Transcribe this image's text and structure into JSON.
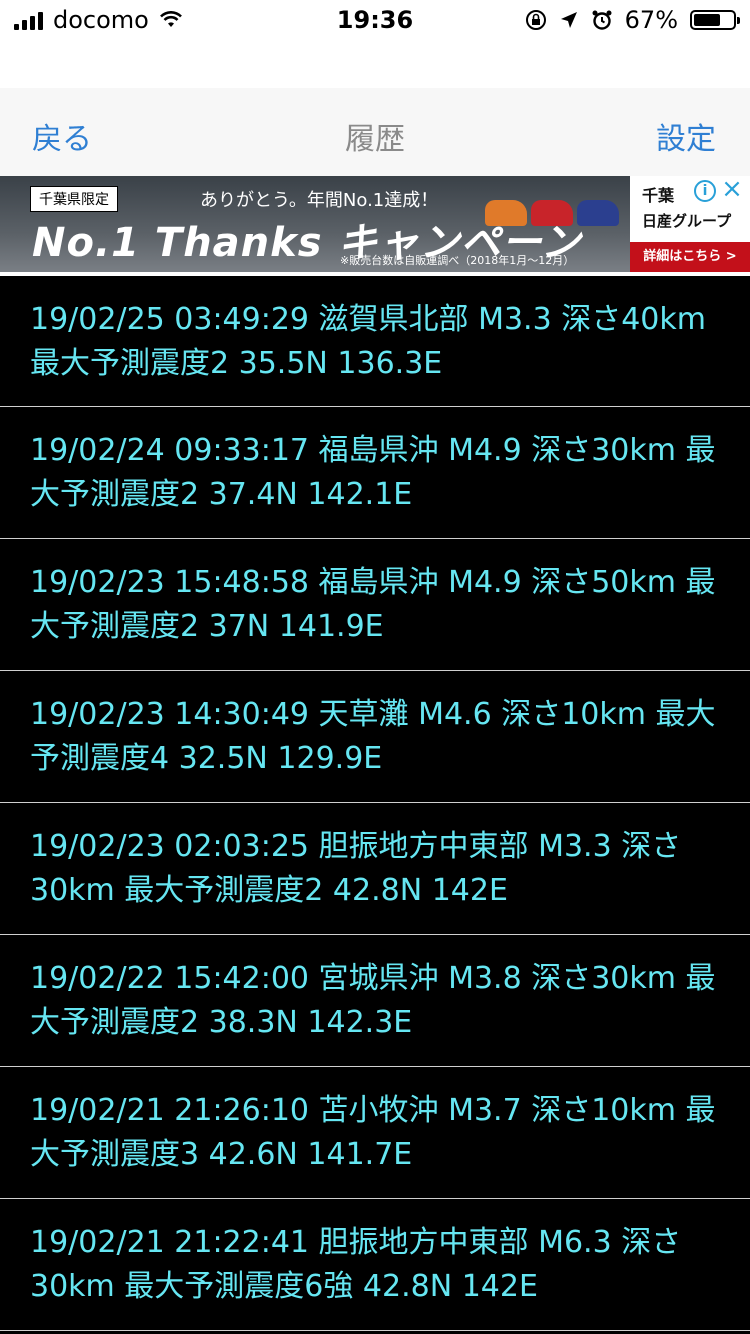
{
  "status_bar": {
    "carrier": "docomo",
    "time": "19:36",
    "battery": "67%"
  },
  "nav": {
    "back_label": "戻る",
    "title": "履歴",
    "settings_label": "設定"
  },
  "ad": {
    "tag": "千葉県限定",
    "headline_small": "ありがとう。年間No.1達成！",
    "headline": "No.1 Thanks キャンペーン",
    "fineprint": "※販売台数は自販連調べ（2018年1月〜12月）",
    "brand_name": "千葉",
    "brand_group": "日産グループ",
    "detail_button": "詳細はこちら >"
  },
  "history": [
    "19/02/25 03:49:29 滋賀県北部 M3.3 深さ40km 最大予測震度2 35.5N 136.3E",
    "19/02/24 09:33:17 福島県沖 M4.9 深さ30km 最大予測震度2 37.4N 142.1E",
    "19/02/23 15:48:58 福島県沖 M4.9 深さ50km 最大予測震度2 37N 141.9E",
    "19/02/23 14:30:49 天草灘 M4.6 深さ10km 最大予測震度4 32.5N 129.9E",
    "19/02/23 02:03:25 胆振地方中東部 M3.3 深さ30km 最大予測震度2 42.8N 142E",
    "19/02/22 15:42:00 宮城県沖 M3.8 深さ30km 最大予測震度2 38.3N 142.3E",
    "19/02/21 21:26:10 苫小牧沖 M3.7 深さ10km 最大予測震度3 42.6N 141.7E",
    "19/02/21 21:22:41 胆振地方中東部 M6.3 深さ30km 最大予測震度6強 42.8N 142E"
  ],
  "colors": {
    "accent": "#2f7fd3",
    "list_text": "#66e6f2",
    "background": "#000000"
  }
}
